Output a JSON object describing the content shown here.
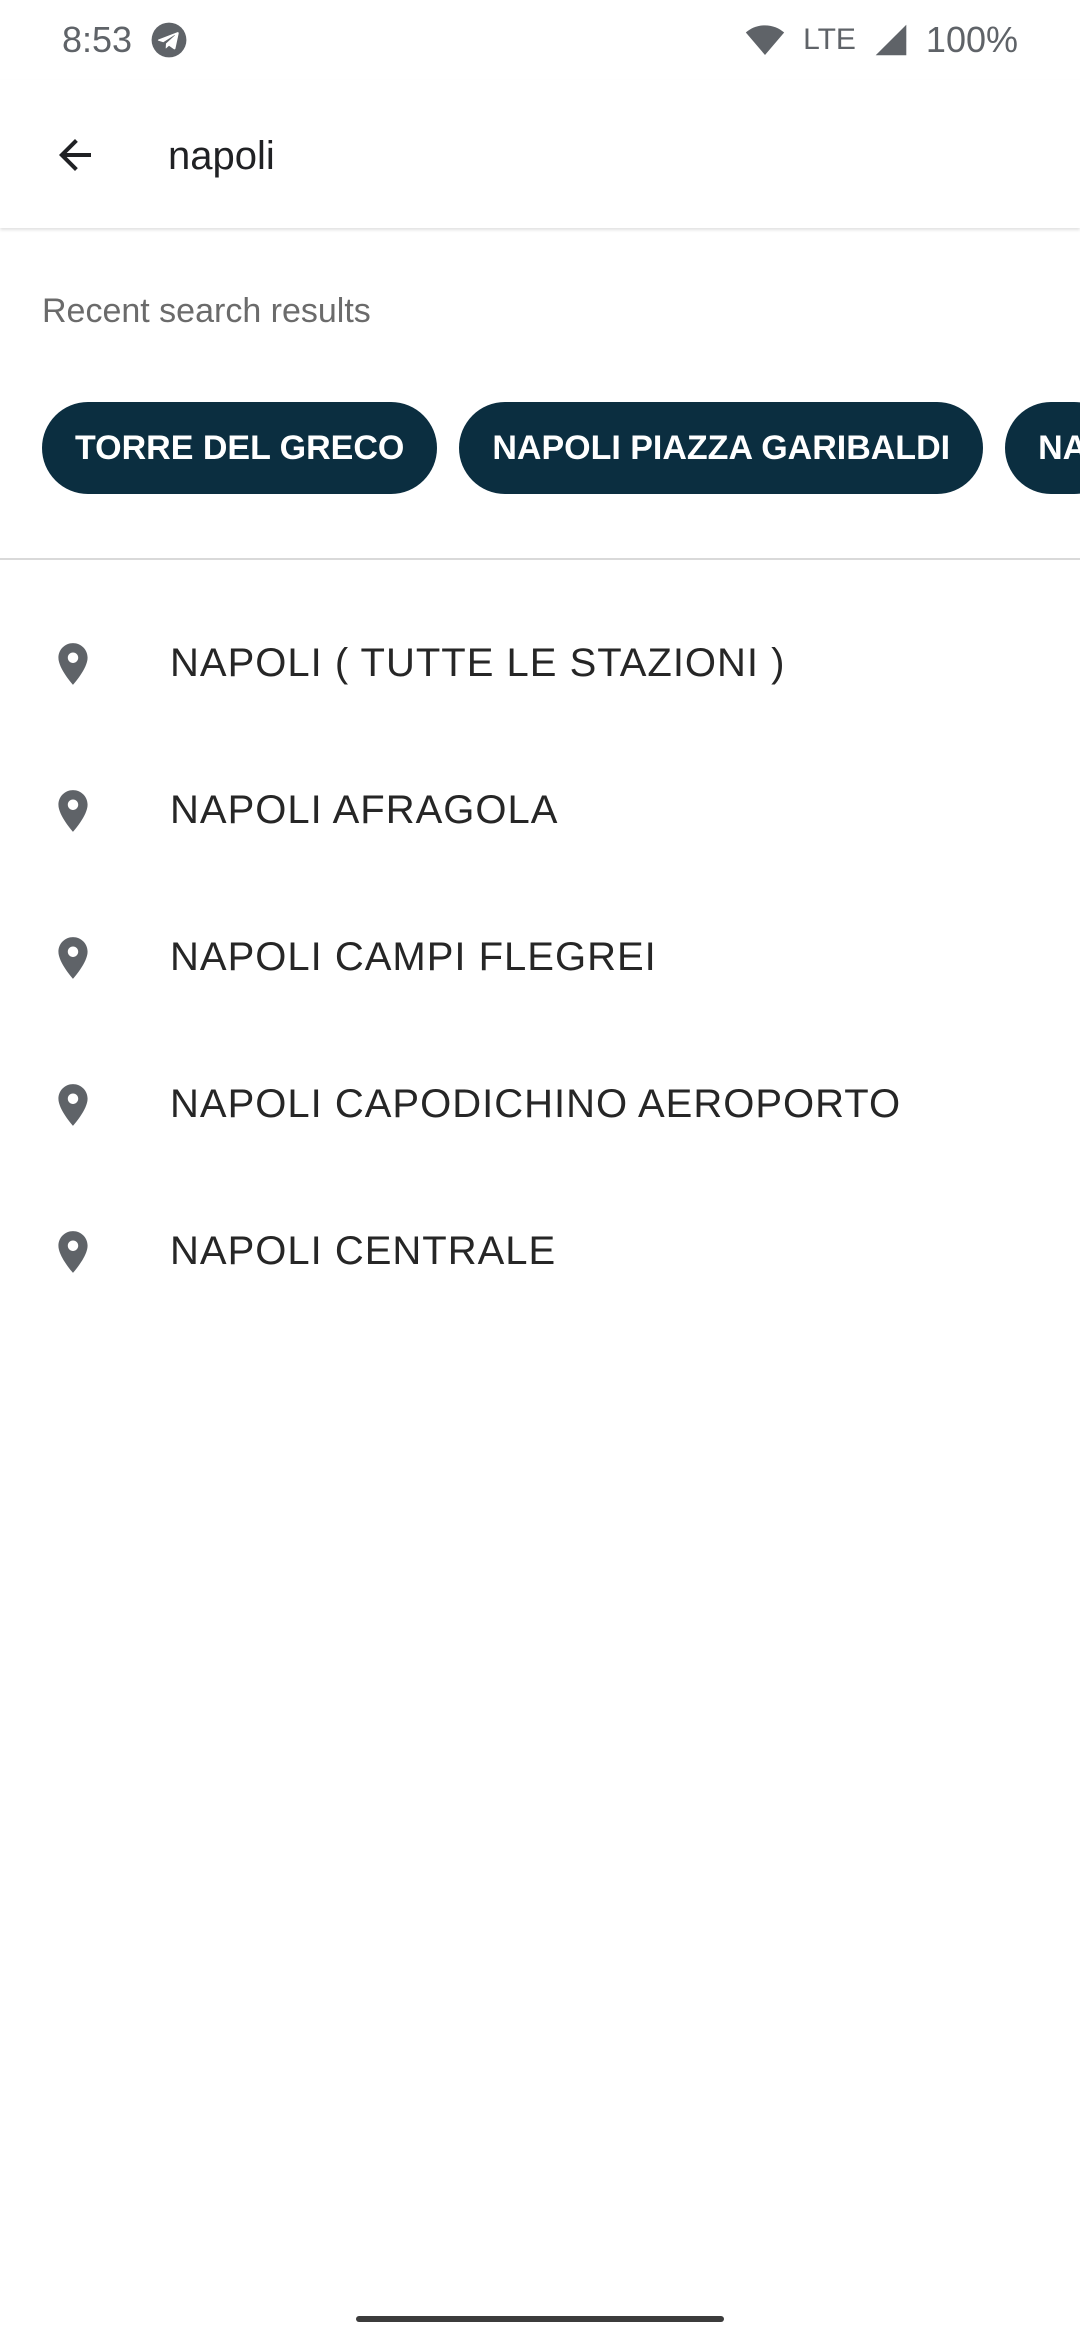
{
  "status_bar": {
    "time": "8:53",
    "network": "LTE",
    "battery": "100%",
    "icons": [
      "telegram-icon",
      "wifi-icon",
      "signal-icon"
    ]
  },
  "search": {
    "value": "napoli",
    "back_icon": "arrow-back-icon"
  },
  "recent": {
    "title": "Recent search results",
    "chips": [
      {
        "label": "TORRE DEL GRECO"
      },
      {
        "label": "NAPOLI PIAZZA GARIBALDI"
      },
      {
        "label": "NA"
      }
    ]
  },
  "results": [
    {
      "label": "NAPOLI ( TUTTE LE STAZIONI )",
      "icon": "location-pin-icon"
    },
    {
      "label": "NAPOLI AFRAGOLA",
      "icon": "location-pin-icon"
    },
    {
      "label": "NAPOLI CAMPI FLEGREI",
      "icon": "location-pin-icon"
    },
    {
      "label": "NAPOLI CAPODICHINO AEROPORTO",
      "icon": "location-pin-icon"
    },
    {
      "label": "NAPOLI CENTRALE",
      "icon": "location-pin-icon"
    }
  ],
  "colors": {
    "chip_background": "#0b2e40",
    "chip_text": "#ffffff",
    "pin": "#5f6368"
  }
}
